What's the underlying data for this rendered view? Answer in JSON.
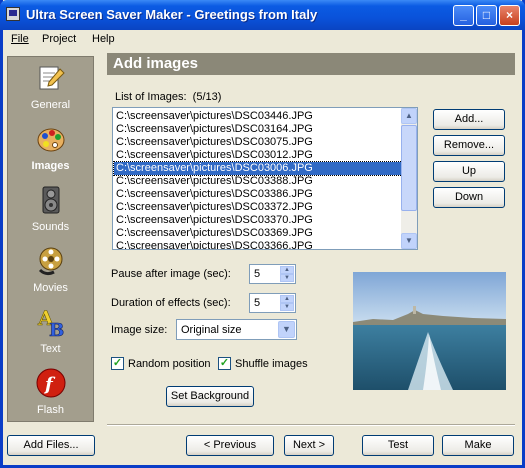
{
  "window": {
    "title": "Ultra Screen Saver Maker - Greetings from Italy"
  },
  "menu": [
    "File",
    "Project",
    "Help"
  ],
  "sidebar": {
    "items": [
      {
        "label": "General",
        "icon": "notepad-pencil-icon",
        "active": false
      },
      {
        "label": "Images",
        "icon": "palette-icon",
        "active": true
      },
      {
        "label": "Sounds",
        "icon": "speaker-icon",
        "active": false
      },
      {
        "label": "Movies",
        "icon": "film-reel-icon",
        "active": false
      },
      {
        "label": "Text",
        "icon": "letters-ab-icon",
        "active": false
      },
      {
        "label": "Flash",
        "icon": "flash-logo-icon",
        "active": false
      }
    ]
  },
  "header": {
    "title": "Add images"
  },
  "images": {
    "list_label": "List of Images:",
    "count": "(5/13)",
    "items": [
      "C:\\screensaver\\pictures\\DSC03446.JPG",
      "C:\\screensaver\\pictures\\DSC03164.JPG",
      "C:\\screensaver\\pictures\\DSC03075.JPG",
      "C:\\screensaver\\pictures\\DSC03012.JPG",
      "C:\\screensaver\\pictures\\DSC03006.JPG",
      "C:\\screensaver\\pictures\\DSC03388.JPG",
      "C:\\screensaver\\pictures\\DSC03386.JPG",
      "C:\\screensaver\\pictures\\DSC03372.JPG",
      "C:\\screensaver\\pictures\\DSC03370.JPG",
      "C:\\screensaver\\pictures\\DSC03369.JPG",
      "C:\\screensaver\\pictures\\DSC03366.JPG"
    ],
    "selected_index": 4
  },
  "actions": {
    "add": "Add...",
    "remove": "Remove...",
    "up": "Up",
    "down": "Down"
  },
  "settings": {
    "pause_label": "Pause after image (sec):",
    "pause_value": "5",
    "duration_label": "Duration of effects (sec):",
    "duration_value": "5",
    "size_label": "Image size:",
    "size_value": "Original size",
    "random_label": "Random position",
    "random_checked": true,
    "shuffle_label": "Shuffle images",
    "shuffle_checked": true,
    "set_background": "Set Background"
  },
  "footer": {
    "add_files": "Add Files...",
    "previous": "< Previous",
    "next": "Next >",
    "test": "Test",
    "make": "Make"
  },
  "colors": {
    "selection": "#316AC5",
    "titlebar": "#0A52DA",
    "sidebar": "#A39E8D",
    "header": "#8B8878"
  }
}
